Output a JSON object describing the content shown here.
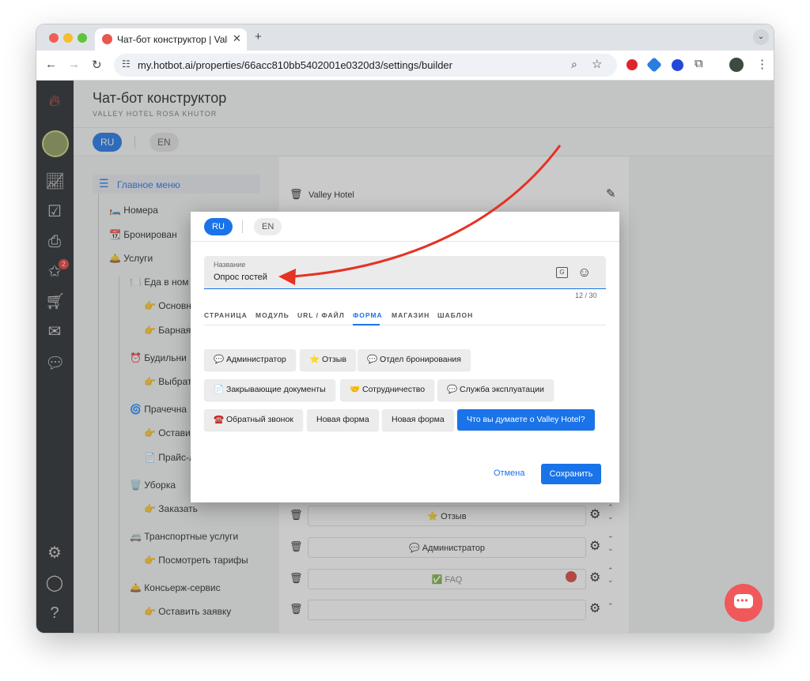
{
  "browser": {
    "tab_title": "Чат-бот конструктор | Valley",
    "url": "my.hotbot.ai/properties/66acc810bb5402001e0320d3/settings/builder"
  },
  "page": {
    "title": "Чат-бот конструктор",
    "subtitle": "VALLEY HOTEL ROSA KHUTOR",
    "lang_active": "RU",
    "lang_other": "EN",
    "badge_count": "2"
  },
  "tree": {
    "main_menu": "Главное меню",
    "items": [
      "🛏️ Номера",
      "📆 Бронирован",
      "🛎️ Услуги",
      "🍽️ Еда в ном",
      "👉 Основн",
      "👉 Барная",
      "⏰ Будильни",
      "👉 Выбрат",
      "🌀 Прачечна",
      "👉 Остави",
      "📄 Прайс-л",
      "🗑️ Уборка",
      "👉 Заказать",
      "🚐 Транспортные услуги",
      "👉 Посмотреть тарифы",
      "🛎️ Консьерж-сервис",
      "👉 Оставить заявку"
    ]
  },
  "mid": {
    "header_item": "Valley Hotel",
    "rows": [
      "⭐ Отзыв",
      "💬 Администратор",
      "✅ FAQ",
      ""
    ]
  },
  "modal": {
    "lang_active": "RU",
    "lang_other": "EN",
    "field_label": "Название",
    "field_value": "Опрос гостей",
    "counter": "12 / 30",
    "tabs": [
      "СТРАНИЦА",
      "МОДУЛЬ",
      "URL / ФАЙЛ",
      "ФОРМА",
      "МАГАЗИН",
      "ШАБЛОН"
    ],
    "active_tab": "ФОРМА",
    "chips": [
      "💬 Администратор",
      "⭐ Отзыв",
      "💬 Отдел бронирования",
      "📄 Закрывающие документы",
      "🤝 Сотрудничество",
      "💬 Служба эксплуатации",
      "☎️ Обратный звонок",
      "Новая форма",
      "Новая форма",
      "Что вы думаете о Valley Hotel?"
    ],
    "cancel_label": "Отмена",
    "save_label": "Сохранить"
  },
  "colors": {
    "accent": "#1a73e8",
    "arrow": "#e53224",
    "fab": "#f0585a"
  }
}
